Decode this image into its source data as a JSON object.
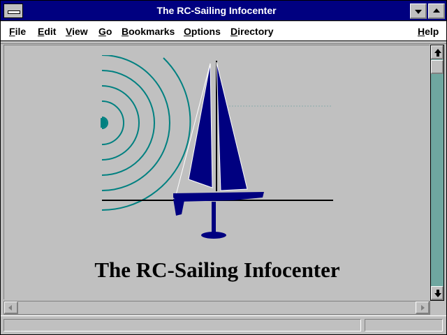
{
  "window": {
    "title": "The RC-Sailing Infocenter"
  },
  "menu": {
    "file": "File",
    "edit": "Edit",
    "view": "View",
    "go": "Go",
    "bookmarks": "Bookmarks",
    "options": "Options",
    "directory": "Directory",
    "help": "Help"
  },
  "content": {
    "heading": "The RC-Sailing Infocenter",
    "logo_colors": {
      "boat": "#000080",
      "waves": "#008080"
    }
  },
  "status": {
    "text": ""
  },
  "icons": {
    "system_menu": "system-menu-icon",
    "minimize": "minimize-icon",
    "maximize": "maximize-icon",
    "scroll_up": "arrow-up-icon",
    "scroll_down": "arrow-down-icon",
    "scroll_left": "arrow-left-icon",
    "scroll_right": "arrow-right-icon"
  }
}
